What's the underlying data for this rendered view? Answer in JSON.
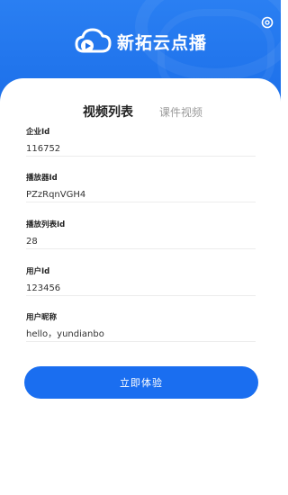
{
  "app": {
    "name": "新拓云点播"
  },
  "icons": {
    "logo": "cloud-play-icon",
    "settings": "gear-icon"
  },
  "colors": {
    "brand_blue": "#1a6de8",
    "button_blue": "#1a6ef0"
  },
  "tabs": [
    {
      "label": "视频列表",
      "active": true
    },
    {
      "label": "课件视频",
      "active": false
    }
  ],
  "form": {
    "fields": [
      {
        "label": "企业Id",
        "value": "116752"
      },
      {
        "label": "播放器Id",
        "value": "PZzRqnVGH4"
      },
      {
        "label": "播放列表Id",
        "value": "28"
      },
      {
        "label": "用户Id",
        "value": "123456"
      },
      {
        "label": "用户昵称",
        "value": "hello，yundianbo"
      }
    ],
    "submit_label": "立即体验"
  }
}
